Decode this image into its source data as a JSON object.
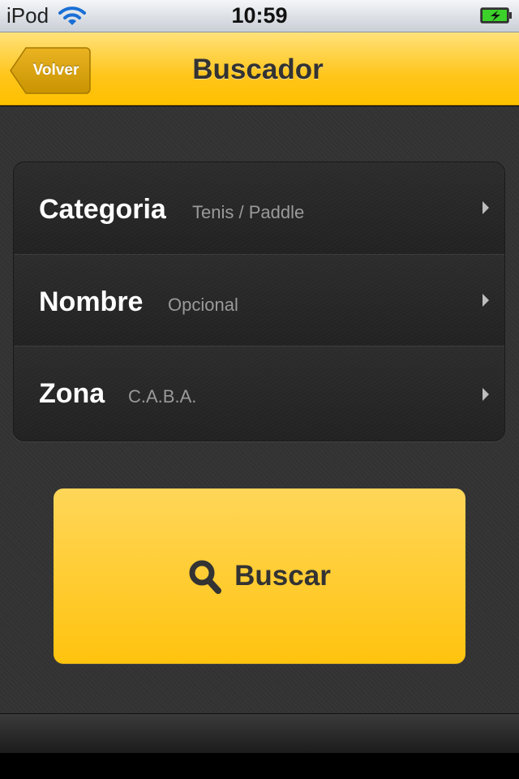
{
  "status_bar": {
    "carrier": "iPod",
    "wifi_icon": "wifi-icon",
    "time": "10:59",
    "battery_icon": "battery-charging-icon"
  },
  "nav": {
    "back_label": "Volver",
    "title": "Buscador"
  },
  "form": {
    "rows": [
      {
        "label": "Categoria",
        "value": "Tenis / Paddle",
        "icon": "chevron-right-icon"
      },
      {
        "label": "Nombre",
        "value": "Opcional",
        "icon": "chevron-right-icon"
      },
      {
        "label": "Zona",
        "value": "C.A.B.A.",
        "icon": "chevron-right-icon"
      }
    ]
  },
  "search_button": {
    "label": "Buscar",
    "icon": "search-icon"
  },
  "colors": {
    "accent": "#ffc30e",
    "background": "#333333",
    "row_label": "#ffffff",
    "row_value": "#9a9a9a"
  }
}
